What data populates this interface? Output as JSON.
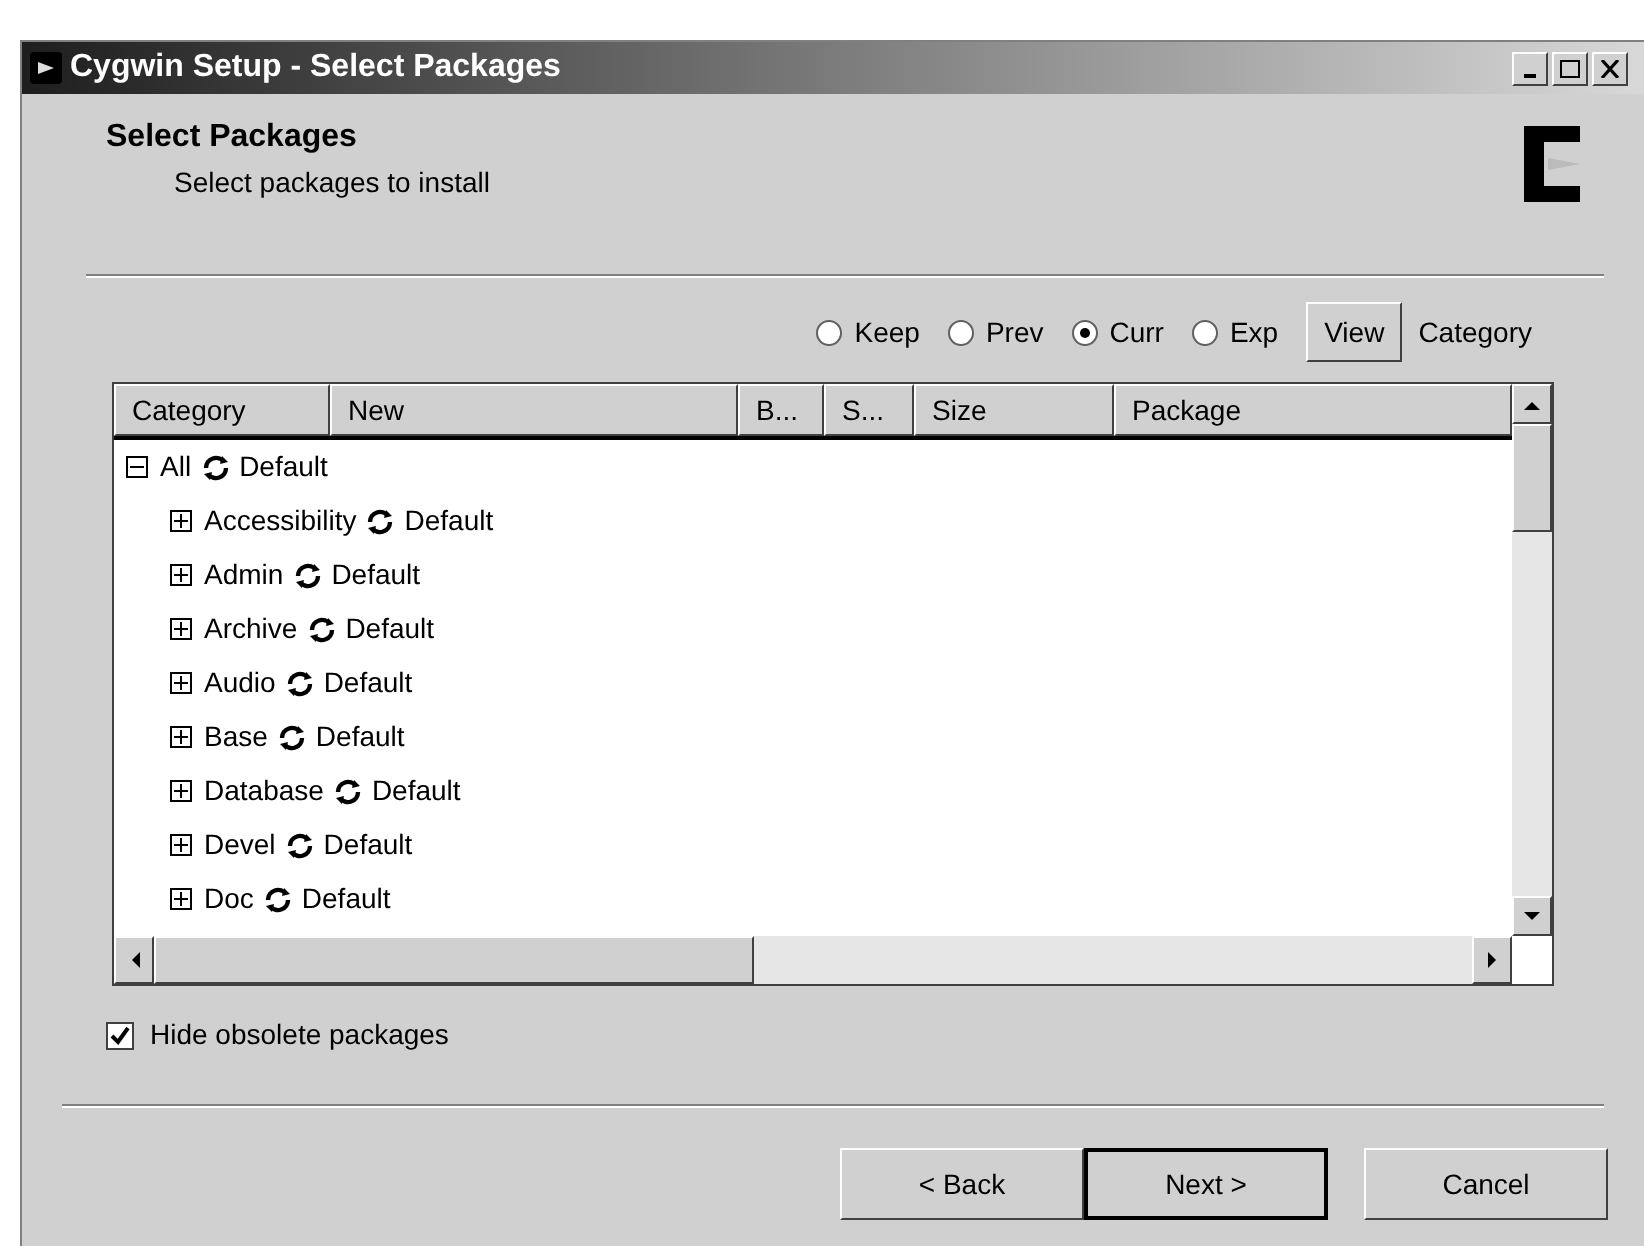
{
  "window": {
    "title": "Cygwin Setup - Select Packages"
  },
  "header": {
    "title": "Select Packages",
    "subtitle": "Select packages to install"
  },
  "radios": [
    {
      "label": "Keep",
      "selected": false
    },
    {
      "label": "Prev",
      "selected": false
    },
    {
      "label": "Curr",
      "selected": true
    },
    {
      "label": "Exp",
      "selected": false
    }
  ],
  "view_button": "View",
  "view_mode": "Category",
  "table": {
    "columns": [
      "Category",
      "New",
      "B...",
      "S...",
      "Size",
      "Package"
    ],
    "tree": {
      "label": "All",
      "status": "Default",
      "expanded": true,
      "children": [
        {
          "label": "Accessibility",
          "status": "Default",
          "expanded": false
        },
        {
          "label": "Admin",
          "status": "Default",
          "expanded": false
        },
        {
          "label": "Archive",
          "status": "Default",
          "expanded": false
        },
        {
          "label": "Audio",
          "status": "Default",
          "expanded": false
        },
        {
          "label": "Base",
          "status": "Default",
          "expanded": false
        },
        {
          "label": "Database",
          "status": "Default",
          "expanded": false
        },
        {
          "label": "Devel",
          "status": "Default",
          "expanded": false
        },
        {
          "label": "Doc",
          "status": "Default",
          "expanded": false
        }
      ]
    }
  },
  "hide_obsolete": {
    "label": "Hide obsolete packages",
    "checked": true
  },
  "buttons": [
    "< Back",
    "Next >",
    "Cancel"
  ]
}
